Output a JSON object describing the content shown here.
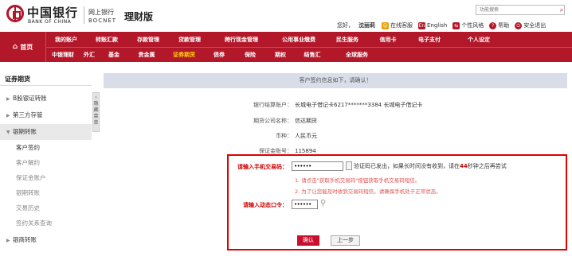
{
  "header": {
    "logo_cn": "中国银行",
    "logo_en": "BANK OF CHINA",
    "ebank_cn": "网上银行",
    "ebank_en": "BOCNET",
    "product_title": "理财版",
    "search_placeholder": "功能搜索",
    "greeting": "您好，",
    "nickname": "沈丽莉",
    "links": [
      {
        "label": "在线客服",
        "icon": "customer-service-icon",
        "color": "#e8a000"
      },
      {
        "label": "English",
        "icon": "english-icon",
        "color": "#b3182a"
      },
      {
        "label": "个性风格",
        "icon": "style-icon",
        "color": "#b3182a"
      },
      {
        "label": "帮助",
        "icon": "help-icon",
        "color": "#b3182a"
      },
      {
        "label": "安全退出",
        "icon": "logout-icon",
        "color": "#b3182a"
      }
    ]
  },
  "nav": {
    "home": "首页",
    "row1": [
      "我的账户",
      "转账汇款",
      "存款管理",
      "贷款管理",
      "跨行现金管理",
      "公用事业缴费",
      "民生服务",
      "信用卡",
      "电子支付",
      "个人设定"
    ],
    "row2": [
      "中银理财",
      "外汇",
      "基金",
      "贵金属",
      "证券期货",
      "债券",
      "保险",
      "期权",
      "结售汇",
      "全球服务"
    ],
    "active_row2": "证券期货"
  },
  "sidebar": {
    "title": "证券期货",
    "items": [
      {
        "label": "B股银证转账",
        "caret": "▶",
        "expanded": false
      },
      {
        "label": "第三方存管",
        "caret": "▶",
        "expanded": false
      },
      {
        "label": "银期转账",
        "caret": "▼",
        "expanded": true
      },
      {
        "label": "银商转账",
        "caret": "▶",
        "expanded": false
      }
    ],
    "subitems": [
      "客户签约",
      "客户解约",
      "保证金账户",
      "银期转账",
      "交易历史",
      "签约关系查询"
    ],
    "current_sub": "客户签约",
    "collapse_label": "隐藏菜单"
  },
  "content": {
    "notice": "客户签约信息如下，请确认！",
    "fields": [
      {
        "label": "银行结算账户：",
        "value": "长城电子借记卡6217*******3384 长城电子借记卡"
      },
      {
        "label": "期货公司名称：",
        "value": "信达期货"
      },
      {
        "label": "币种：",
        "value": "人民币元"
      },
      {
        "label": "保证金账号：",
        "value": "115894"
      }
    ],
    "phone_code_label": "请输入手机交易码：",
    "phone_code_value": "••••••",
    "verify_text_a": "验证码已发出，如果长时间没有收到，请在",
    "verify_seconds": "44",
    "verify_text_b": "秒钟之后再尝试",
    "tip1": "1. 请点击\"获取手机交易码\"按钮获取手机交易码短信。",
    "tip2": "2. 为了让您能及时收到交易码短信，请确保手机处于正常状态。",
    "dynamic_label": "请输入动态口令：",
    "dynamic_value": "••••••",
    "btn_ok": "确认",
    "btn_back": "上一步"
  }
}
